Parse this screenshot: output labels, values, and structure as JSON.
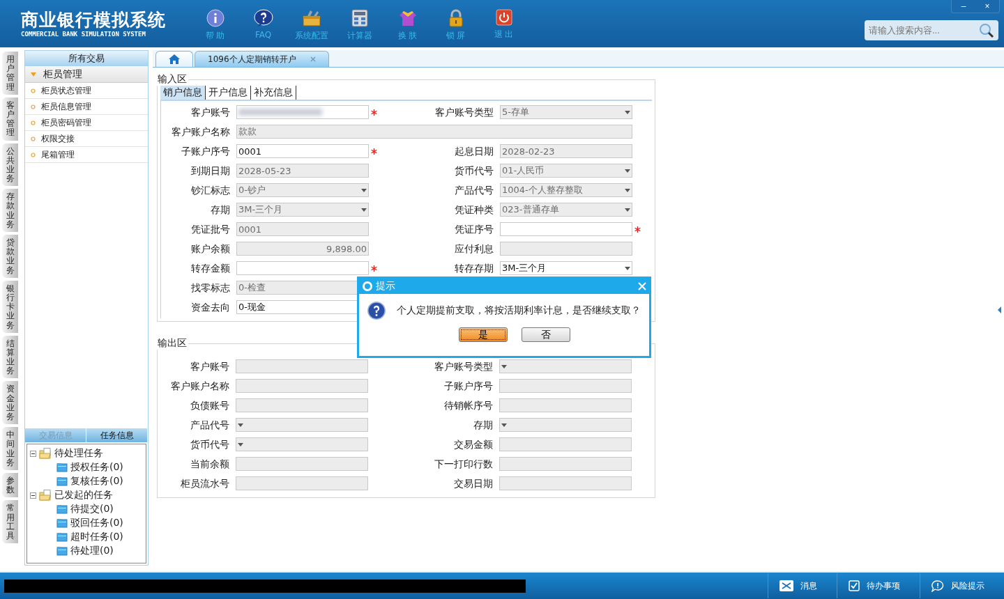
{
  "header": {
    "title": "商业银行模拟系统",
    "subtitle": "COMMERCIAL BANK SIMULATION SYSTEM",
    "toolbar": [
      {
        "kind": "help",
        "label": "帮 助"
      },
      {
        "kind": "faq",
        "label": "FAQ"
      },
      {
        "kind": "config",
        "label": "系统配置"
      },
      {
        "kind": "calculator",
        "label": "计算器"
      },
      {
        "kind": "skin",
        "label": "换 肤"
      },
      {
        "kind": "lock",
        "label": "锁 屏"
      },
      {
        "kind": "exit",
        "label": "退 出"
      }
    ],
    "window_controls": [
      "–",
      "×"
    ],
    "search": {
      "placeholder": "请输入搜索内容..."
    }
  },
  "side_tabs": [
    {
      "label": "用户管理",
      "selected": false
    },
    {
      "label": "客户管理",
      "selected": false
    },
    {
      "label": "公共业务",
      "selected": false
    },
    {
      "label": "存款业务",
      "selected": false
    },
    {
      "label": "贷款业务",
      "selected": false
    },
    {
      "label": "银行卡业务",
      "selected": false
    },
    {
      "label": "结算业务",
      "selected": false
    },
    {
      "label": "资金业务",
      "selected": false
    },
    {
      "label": "中间业务",
      "selected": false
    },
    {
      "label": "参数",
      "selected": false
    },
    {
      "label": "常用工具",
      "selected": false
    }
  ],
  "menu": {
    "header": "所有交易",
    "group": {
      "label": "柜员管理",
      "expanded": true
    },
    "items": [
      "柜员状态管理",
      "柜员信息管理",
      "柜员密码管理",
      "权限交接",
      "尾箱管理"
    ]
  },
  "task_panel": {
    "tabs": [
      {
        "label": "交易信息",
        "selected": false
      },
      {
        "label": "任务信息",
        "selected": true
      }
    ],
    "tree": [
      {
        "label": "待处理任务",
        "expanded": true,
        "children": [
          {
            "label": "授权任务(0)"
          },
          {
            "label": "复核任务(0)"
          }
        ]
      },
      {
        "label": "已发起的任务",
        "expanded": true,
        "children": [
          {
            "label": "待提交(0)"
          },
          {
            "label": "驳回任务(0)"
          },
          {
            "label": "超时任务(0)"
          },
          {
            "label": "待处理(0)"
          }
        ]
      }
    ]
  },
  "doc_tabs": [
    {
      "kind": "home",
      "selected": false
    },
    {
      "kind": "page",
      "label": "1096个人定期销转开户",
      "selected": true
    }
  ],
  "input_area": {
    "legend": "输入区",
    "tabs": [
      {
        "label": "销户信息",
        "selected": true
      },
      {
        "label": "开户信息",
        "selected": false
      },
      {
        "label": "补充信息",
        "selected": false
      }
    ],
    "rows": [
      {
        "fields": [
          {
            "label": "客户账号",
            "kind": "text",
            "redacted": true,
            "disabled": false,
            "required": true
          },
          {
            "label": "客户账号类型",
            "kind": "select",
            "value": "5-存单",
            "disabled": true
          }
        ]
      },
      {
        "fields": [
          {
            "label": "客户账户名称",
            "kind": "wide",
            "value": "款款",
            "disabled": true
          }
        ]
      },
      {
        "fields": [
          {
            "label": "子账户序号",
            "kind": "text",
            "value": "0001",
            "disabled": false,
            "required": true
          },
          {
            "label": "起息日期",
            "kind": "text",
            "value": "2028-02-23",
            "disabled": true
          }
        ]
      },
      {
        "fields": [
          {
            "label": "到期日期",
            "kind": "text",
            "value": "2028-05-23",
            "disabled": true
          },
          {
            "label": "货币代号",
            "kind": "select",
            "value": "01-人民币",
            "disabled": true
          }
        ]
      },
      {
        "fields": [
          {
            "label": "钞汇标志",
            "kind": "select",
            "value": "0-钞户",
            "disabled": true
          },
          {
            "label": "产品代号",
            "kind": "select",
            "value": "1004-个人整存整取",
            "disabled": true
          }
        ]
      },
      {
        "fields": [
          {
            "label": "存期",
            "kind": "select",
            "value": "3M-三个月",
            "disabled": true
          },
          {
            "label": "凭证种类",
            "kind": "select",
            "value": "023-普通存单",
            "disabled": true
          }
        ]
      },
      {
        "fields": [
          {
            "label": "凭证批号",
            "kind": "text",
            "value": "0001",
            "disabled": true
          },
          {
            "label": "凭证序号",
            "kind": "text",
            "disabled": false,
            "required": true
          }
        ]
      },
      {
        "fields": [
          {
            "label": "账户余额",
            "kind": "amount",
            "value": "9,898.00",
            "disabled": true
          },
          {
            "label": "应付利息",
            "kind": "text",
            "disabled": true
          }
        ]
      },
      {
        "fields": [
          {
            "label": "转存金额",
            "kind": "text",
            "disabled": false,
            "required": true
          },
          {
            "label": "转存存期",
            "kind": "select",
            "value": "3M-三个月",
            "disabled": false
          }
        ]
      },
      {
        "fields": [
          {
            "label": "找零标志",
            "kind": "text",
            "value": "0-检查",
            "disabled": true
          }
        ]
      },
      {
        "fields": [
          {
            "label": "资金去向",
            "kind": "text",
            "value": "0-现金",
            "disabled": false
          }
        ]
      }
    ]
  },
  "output_area": {
    "legend": "输出区",
    "rows": [
      {
        "fields": [
          {
            "label": "客户账号",
            "kind": "text",
            "disabled": true
          },
          {
            "label": "客户账号类型",
            "kind": "select",
            "disabled": true
          }
        ]
      },
      {
        "fields": [
          {
            "label": "客户账户名称",
            "kind": "text",
            "disabled": true
          },
          {
            "label": "子账户序号",
            "kind": "text",
            "disabled": true
          }
        ]
      },
      {
        "fields": [
          {
            "label": "负债账号",
            "kind": "text",
            "disabled": true
          },
          {
            "label": "待销帐序号",
            "kind": "text",
            "disabled": true
          }
        ]
      },
      {
        "fields": [
          {
            "label": "产品代号",
            "kind": "select",
            "disabled": true
          },
          {
            "label": "存期",
            "kind": "select",
            "disabled": true
          }
        ]
      },
      {
        "fields": [
          {
            "label": "货币代号",
            "kind": "select",
            "disabled": true
          },
          {
            "label": "交易金额",
            "kind": "text",
            "disabled": true
          }
        ]
      },
      {
        "fields": [
          {
            "label": "当前余额",
            "kind": "text",
            "disabled": true
          },
          {
            "label": "下一打印行数",
            "kind": "text",
            "disabled": true
          }
        ]
      },
      {
        "fields": [
          {
            "label": "柜员流水号",
            "kind": "text",
            "disabled": true
          },
          {
            "label": "交易日期",
            "kind": "text",
            "disabled": true
          }
        ]
      }
    ]
  },
  "dialog": {
    "title": "提示",
    "message": "个人定期提前支取，将按活期利率计息，是否继续支取？",
    "buttons": [
      {
        "label": "是",
        "selected": true
      },
      {
        "label": "否",
        "selected": false
      }
    ]
  },
  "status_bar": [
    {
      "kind": "message",
      "label": "消息"
    },
    {
      "kind": "todo",
      "label": "待办事项"
    },
    {
      "kind": "risk",
      "label": "风险提示"
    }
  ]
}
